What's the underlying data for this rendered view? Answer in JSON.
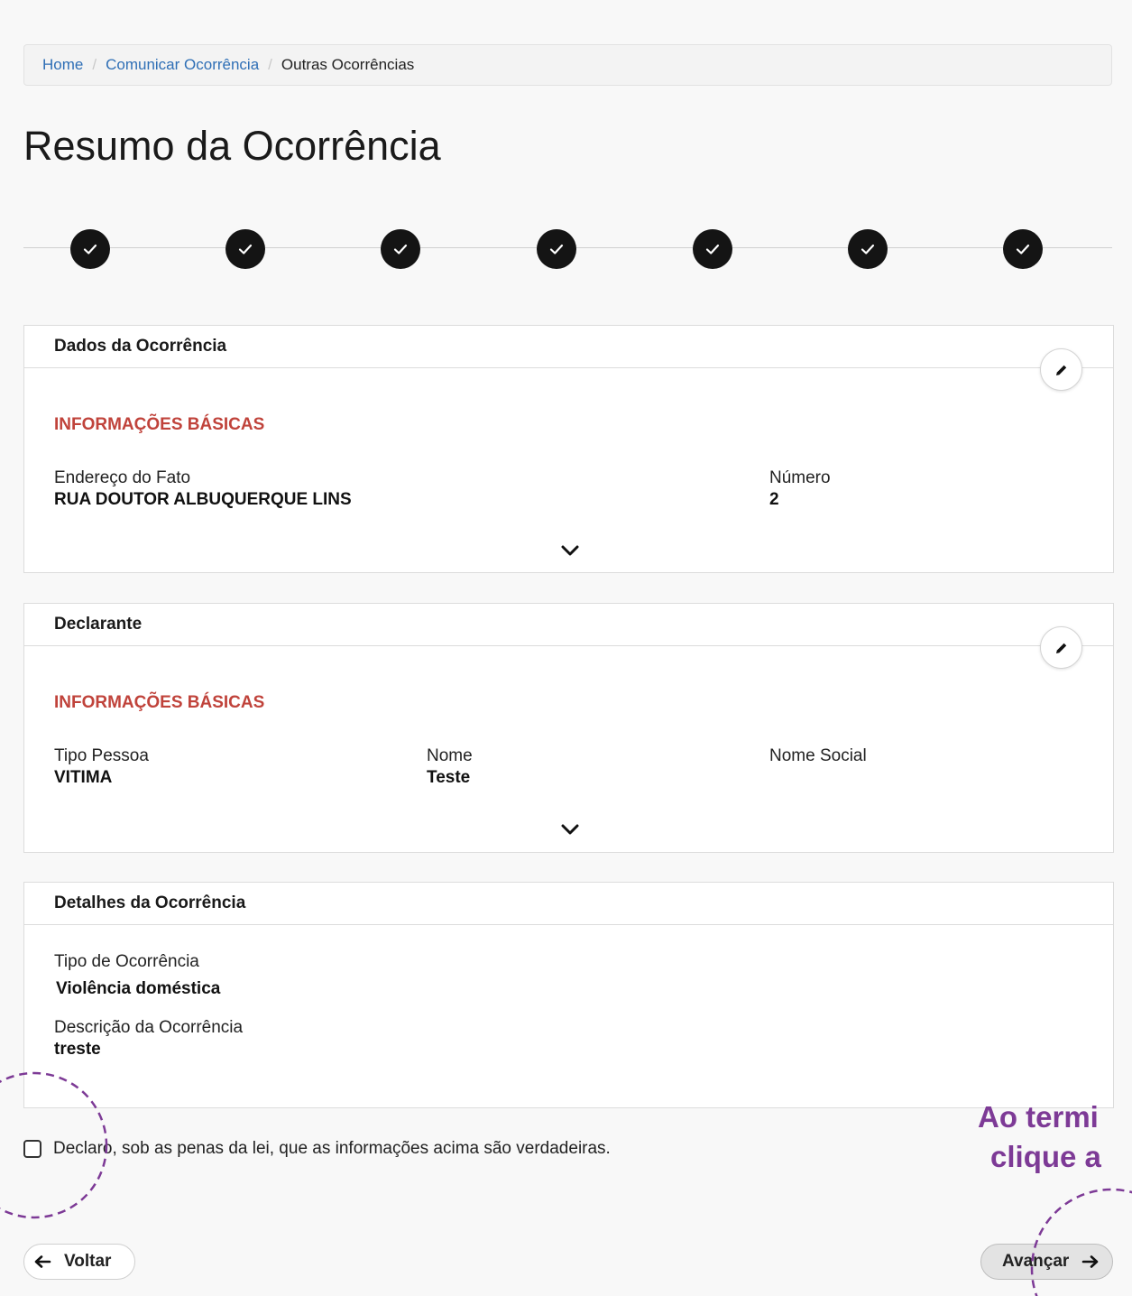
{
  "breadcrumb": {
    "home": "Home",
    "comunicar": "Comunicar Ocorrência",
    "current": "Outras Ocorrências",
    "separator": "/"
  },
  "page_title": "Resumo da Ocorrência",
  "stepper": {
    "steps_completed": 7,
    "total_steps": 7,
    "icon": "check-icon"
  },
  "cards": {
    "dados": {
      "header": "Dados da Ocorrência",
      "section": "INFORMAÇÕES BÁSICAS",
      "fields": [
        {
          "label": "Endereço do Fato",
          "value": "RUA DOUTOR ALBUQUERQUE LINS"
        },
        {
          "label": "Número",
          "value": "2"
        }
      ]
    },
    "declarante": {
      "header": "Declarante",
      "section": "INFORMAÇÕES BÁSICAS",
      "fields": [
        {
          "label": "Tipo Pessoa",
          "value": "VITIMA"
        },
        {
          "label": "Nome",
          "value": "Teste"
        },
        {
          "label": "Nome Social",
          "value": ""
        }
      ]
    },
    "detalhes": {
      "header": "Detalhes da Ocorrência",
      "fields": [
        {
          "label": "Tipo de Ocorrência",
          "value": "Violência doméstica"
        },
        {
          "label": "Descrição da Ocorrência",
          "value": "treste"
        }
      ]
    }
  },
  "declaration": {
    "label": "Declaro, sob as penas da lei, que as informações acima são verdadeiras.",
    "checked": false
  },
  "buttons": {
    "back": "Voltar",
    "next": "Avançar"
  },
  "tip": {
    "line1": "Ao termi",
    "line2": "clique a"
  },
  "colors": {
    "link": "#2f6fb6",
    "section": "#c0433b",
    "tip": "#7d3a96",
    "step": "#141414"
  }
}
